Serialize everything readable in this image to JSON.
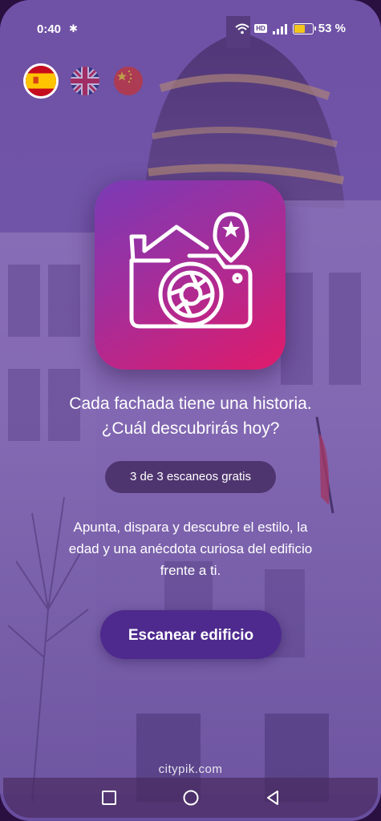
{
  "status_bar": {
    "time": "0:40",
    "battery_percent_label": "53 %",
    "battery_level": 0.53,
    "hd_label": "HD",
    "battery_color": "#f3c71b"
  },
  "languages": [
    {
      "code": "es",
      "icon": "spain-flag-icon",
      "selected": true
    },
    {
      "code": "en",
      "icon": "uk-flag-icon",
      "selected": false
    },
    {
      "code": "zh",
      "icon": "china-flag-icon",
      "selected": false
    }
  ],
  "logo": {
    "icon": "camera-house-pin-icon",
    "gradient": [
      "#7a3bb6",
      "#e01b6a"
    ]
  },
  "headline": {
    "line1": "Cada fachada tiene una historia.",
    "line2": "¿Cuál descubrirás hoy?"
  },
  "scan_counter": "3 de 3 escaneos gratis",
  "description": {
    "line1": "Apunta, dispara y descubre el estilo, la",
    "line2": "edad y una anécdota curiosa del edificio",
    "line3": "frente a ti."
  },
  "primary_button": {
    "label": "Escanear edificio",
    "color": "#4e2a8e"
  },
  "footer": {
    "site": "citypik.com"
  },
  "nav": {
    "icons": [
      "square-recents-icon",
      "circle-home-icon",
      "triangle-back-icon"
    ]
  }
}
